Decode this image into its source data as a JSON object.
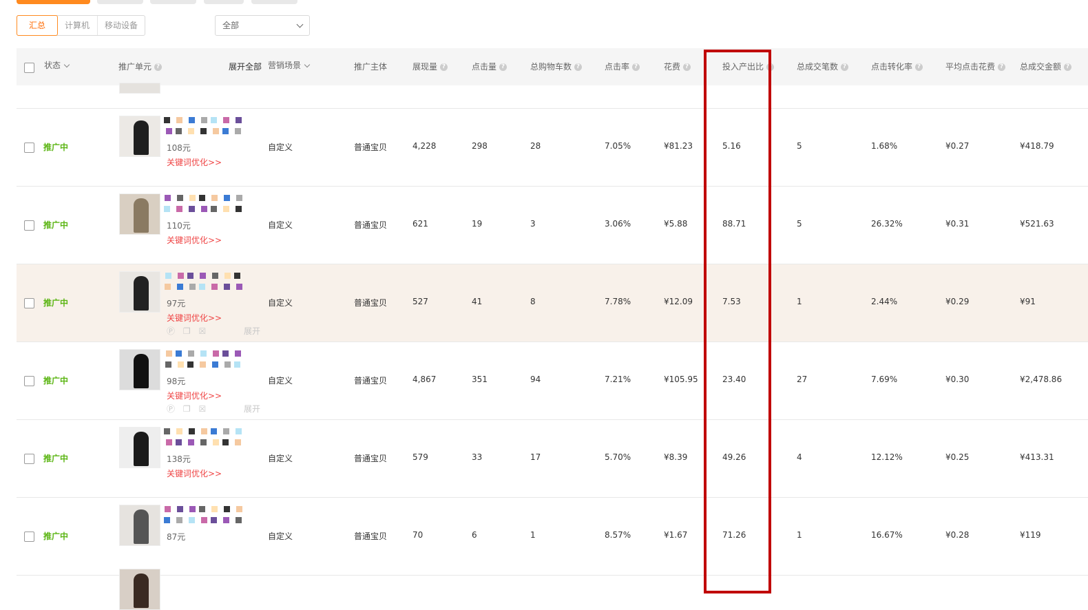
{
  "top_tabs": [
    {
      "active": true
    },
    {
      "active": false
    },
    {
      "active": false
    },
    {
      "active": false
    },
    {
      "active": false
    }
  ],
  "device_tabs": [
    {
      "label": "汇总",
      "active": true
    },
    {
      "label": "计算机",
      "active": false
    },
    {
      "label": "移动设备",
      "active": false
    }
  ],
  "filter": {
    "value": "全部"
  },
  "header": {
    "status": "状态",
    "unit": "推广单元",
    "expand_all": "展开全部",
    "scene": "营销场景",
    "subject": "推广主体",
    "impressions": "展现量",
    "clicks": "点击量",
    "cart": "总购物车数",
    "ctr": "点击率",
    "cost": "花费",
    "roi": "投入产出比",
    "orders": "总成交笔数",
    "cvr": "点击转化率",
    "cpc": "平均点击花费",
    "gmv": "总成交金额"
  },
  "rows": [
    {
      "status": "推广中",
      "price": "108元",
      "kw": "关键词优化>>",
      "scene": "自定义",
      "subject": "普通宝贝",
      "impressions": "4,228",
      "clicks": "298",
      "cart": "28",
      "ctr": "7.05%",
      "cost": "¥81.23",
      "roi": "5.16",
      "orders": "5",
      "cvr": "1.68%",
      "cpc": "¥0.27",
      "gmv": "¥418.79",
      "highlighted": false,
      "ops": false
    },
    {
      "status": "推广中",
      "price": "110元",
      "kw": "关键词优化>>",
      "scene": "自定义",
      "subject": "普通宝贝",
      "impressions": "621",
      "clicks": "19",
      "cart": "3",
      "ctr": "3.06%",
      "cost": "¥5.88",
      "roi": "88.71",
      "orders": "5",
      "cvr": "26.32%",
      "cpc": "¥0.31",
      "gmv": "¥521.63",
      "highlighted": false,
      "ops": false
    },
    {
      "status": "推广中",
      "price": "97元",
      "kw": "关键词优化>>",
      "scene": "自定义",
      "subject": "普通宝贝",
      "impressions": "527",
      "clicks": "41",
      "cart": "8",
      "ctr": "7.78%",
      "cost": "¥12.09",
      "roi": "7.53",
      "orders": "1",
      "cvr": "2.44%",
      "cpc": "¥0.29",
      "gmv": "¥91",
      "highlighted": true,
      "ops": true
    },
    {
      "status": "推广中",
      "price": "98元",
      "kw": "关键词优化>>",
      "scene": "自定义",
      "subject": "普通宝贝",
      "impressions": "4,867",
      "clicks": "351",
      "cart": "94",
      "ctr": "7.21%",
      "cost": "¥105.95",
      "roi": "23.40",
      "orders": "27",
      "cvr": "7.69%",
      "cpc": "¥0.30",
      "gmv": "¥2,478.86",
      "highlighted": false,
      "ops": true
    },
    {
      "status": "推广中",
      "price": "138元",
      "kw": "关键词优化>>",
      "scene": "自定义",
      "subject": "普通宝贝",
      "impressions": "579",
      "clicks": "33",
      "cart": "17",
      "ctr": "5.70%",
      "cost": "¥8.39",
      "roi": "49.26",
      "orders": "4",
      "cvr": "12.12%",
      "cpc": "¥0.25",
      "gmv": "¥413.31",
      "highlighted": false,
      "ops": false
    },
    {
      "status": "推广中",
      "price": "87元",
      "kw": "",
      "scene": "自定义",
      "subject": "普通宝贝",
      "impressions": "70",
      "clicks": "6",
      "cart": "1",
      "ctr": "8.57%",
      "cost": "¥1.67",
      "roi": "71.26",
      "orders": "1",
      "cvr": "16.67%",
      "cpc": "¥0.28",
      "gmv": "¥119",
      "highlighted": false,
      "ops": false
    }
  ],
  "ops_expand_label": "展开",
  "colors": {
    "accent": "#ff8a1f",
    "status": "#5bb513",
    "keyword": "#ef4444",
    "highlight_box": "#c00000"
  }
}
